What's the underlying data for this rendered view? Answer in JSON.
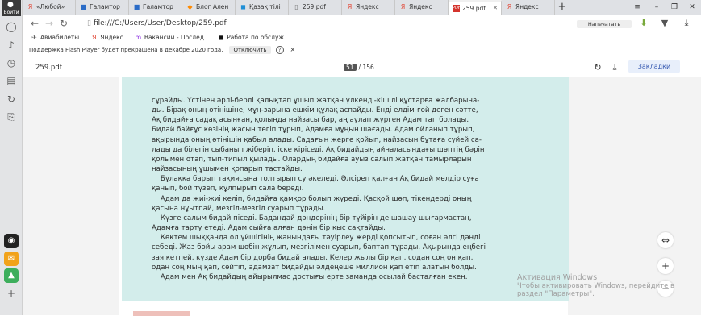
{
  "sidebar": {
    "login_label": "Войти"
  },
  "tabs": [
    {
      "icon": "yandex-icon",
      "title": "«Любой»",
      "color": "#e24b3b"
    },
    {
      "icon": "gallery-icon",
      "title": "Галамтор",
      "color": "#2b6cc7"
    },
    {
      "icon": "gallery-icon",
      "title": "Галамтор",
      "color": "#2b6cc7"
    },
    {
      "icon": "blog-icon",
      "title": "Блог Ален",
      "color": "#ff8a00"
    },
    {
      "icon": "kz-icon",
      "title": "Қазақ тілі",
      "color": "#1f8fd6"
    },
    {
      "icon": "file-icon",
      "title": "259.pdf",
      "color": "#777"
    },
    {
      "icon": "yandex-icon",
      "title": "Яндекс",
      "color": "#e24b3b"
    },
    {
      "icon": "yandex-icon",
      "title": "Яндекс",
      "color": "#e24b3b"
    },
    {
      "icon": "pdf-icon",
      "title": "259.pdf",
      "color": "#d4342d",
      "active": true
    },
    {
      "icon": "yandex-icon",
      "title": "Яндекс",
      "color": "#e24b3b"
    }
  ],
  "address": {
    "url": "file:///C:/Users/User/Desktop/259.pdf",
    "print_label": "Напечатать"
  },
  "bookmarks": [
    {
      "icon": "plane-icon",
      "label": "Авиабилеты"
    },
    {
      "icon": "yandex-icon",
      "label": "Яндекс"
    },
    {
      "icon": "vacancy-icon",
      "label": "Вакансии - Послед."
    },
    {
      "icon": "work-icon",
      "label": "Работа по обслуж."
    }
  ],
  "flash": {
    "message": "Поддержка Flash Player будет прекращена в декабре 2020 года.",
    "disable_label": "Отключить",
    "help": "?",
    "close": "×"
  },
  "pdf": {
    "filename": "259.pdf",
    "current_page": "51",
    "total_pages": "/ 156",
    "bookmarks_label": "Закладки"
  },
  "page_text": [
    "сұрайды. Үстінен әрлі-берлі қалықтап ұшып жатқан үлкенді-кішілі құстарға жалбарына-",
    "ды. Бірақ оның өтінішіне, мұң-зарына ешкім құлақ аспайды. Енді елдім ғой деген сәтте,",
    "Ақ бидайға садақ асынған, қолында найзасы бар, аң аулап жүрген Адам тап болады.",
    "Бидай байғұс көзінің жасын төгіп тұрып, Адамға мұңын шағады. Адам ойланып тұрып,",
    "ақырында оның өтінішін қабыл алады. Садағын жерге қойып, найзасын бұтаға сүйей са-",
    "лады да білегін сыбанып жіберіп, іске кіріседі. Ақ бидайдың айналасындағы шөптің бәрін",
    "қолымен отап, тып-типыл қылады. Олардың бидайға ауыз салып жатқан тамырларын",
    "найзасының ұшымен қопарып тастайды.",
    "    Бұлаққа барып тақиясына толтырып су әкеледі. Әлсіреп қалған Ақ бидай мөлдір суға",
    "қанып, бой түзеп, құлпырып сала береді.",
    "    Адам да жиі-жиі келіп, бидайға қамқор болып жүреді. Қасқой шөп, тікендерді оның",
    "қасына нұытпай, мезгіл-мезгіл суарып тұрады.",
    "    Күзге салым бидай піседі. Бадандай дәндерінің бір түйірін де шашау шығармастан,",
    "Адамға тарту етеді. Адам сыйға алған дәнін бір қыс сақтайды.",
    "    Көктем шыққанда ол үйшігінің жанындағы тәуірлеу жерді қопсытып, соған әлгі дәнді",
    "себеді. Жаз бойы арам шөбін жұлып, мезгілімен суарып, баптап тұрады. Ақырында еңбегі",
    "зая кетпей, күзде Адам бір дорба бидай алады. Келер жылы бір қап, содан соң он қап,",
    "одан соң мың қап, сөйтіп, адамзат бидайды әлдеңеше миллион қап етіп алатын болды.",
    "    Адам мен Ақ бидайдың айырылмас достығы ерте заманда осылай басталған екен."
  ],
  "watermark": {
    "line1": "Активация Windows",
    "line2": "Чтобы активировать Windows, перейдите в",
    "line3": "раздел \"Параметры\"."
  },
  "zoom": {
    "fit": "⇔",
    "plus": "+",
    "minus": "−"
  }
}
